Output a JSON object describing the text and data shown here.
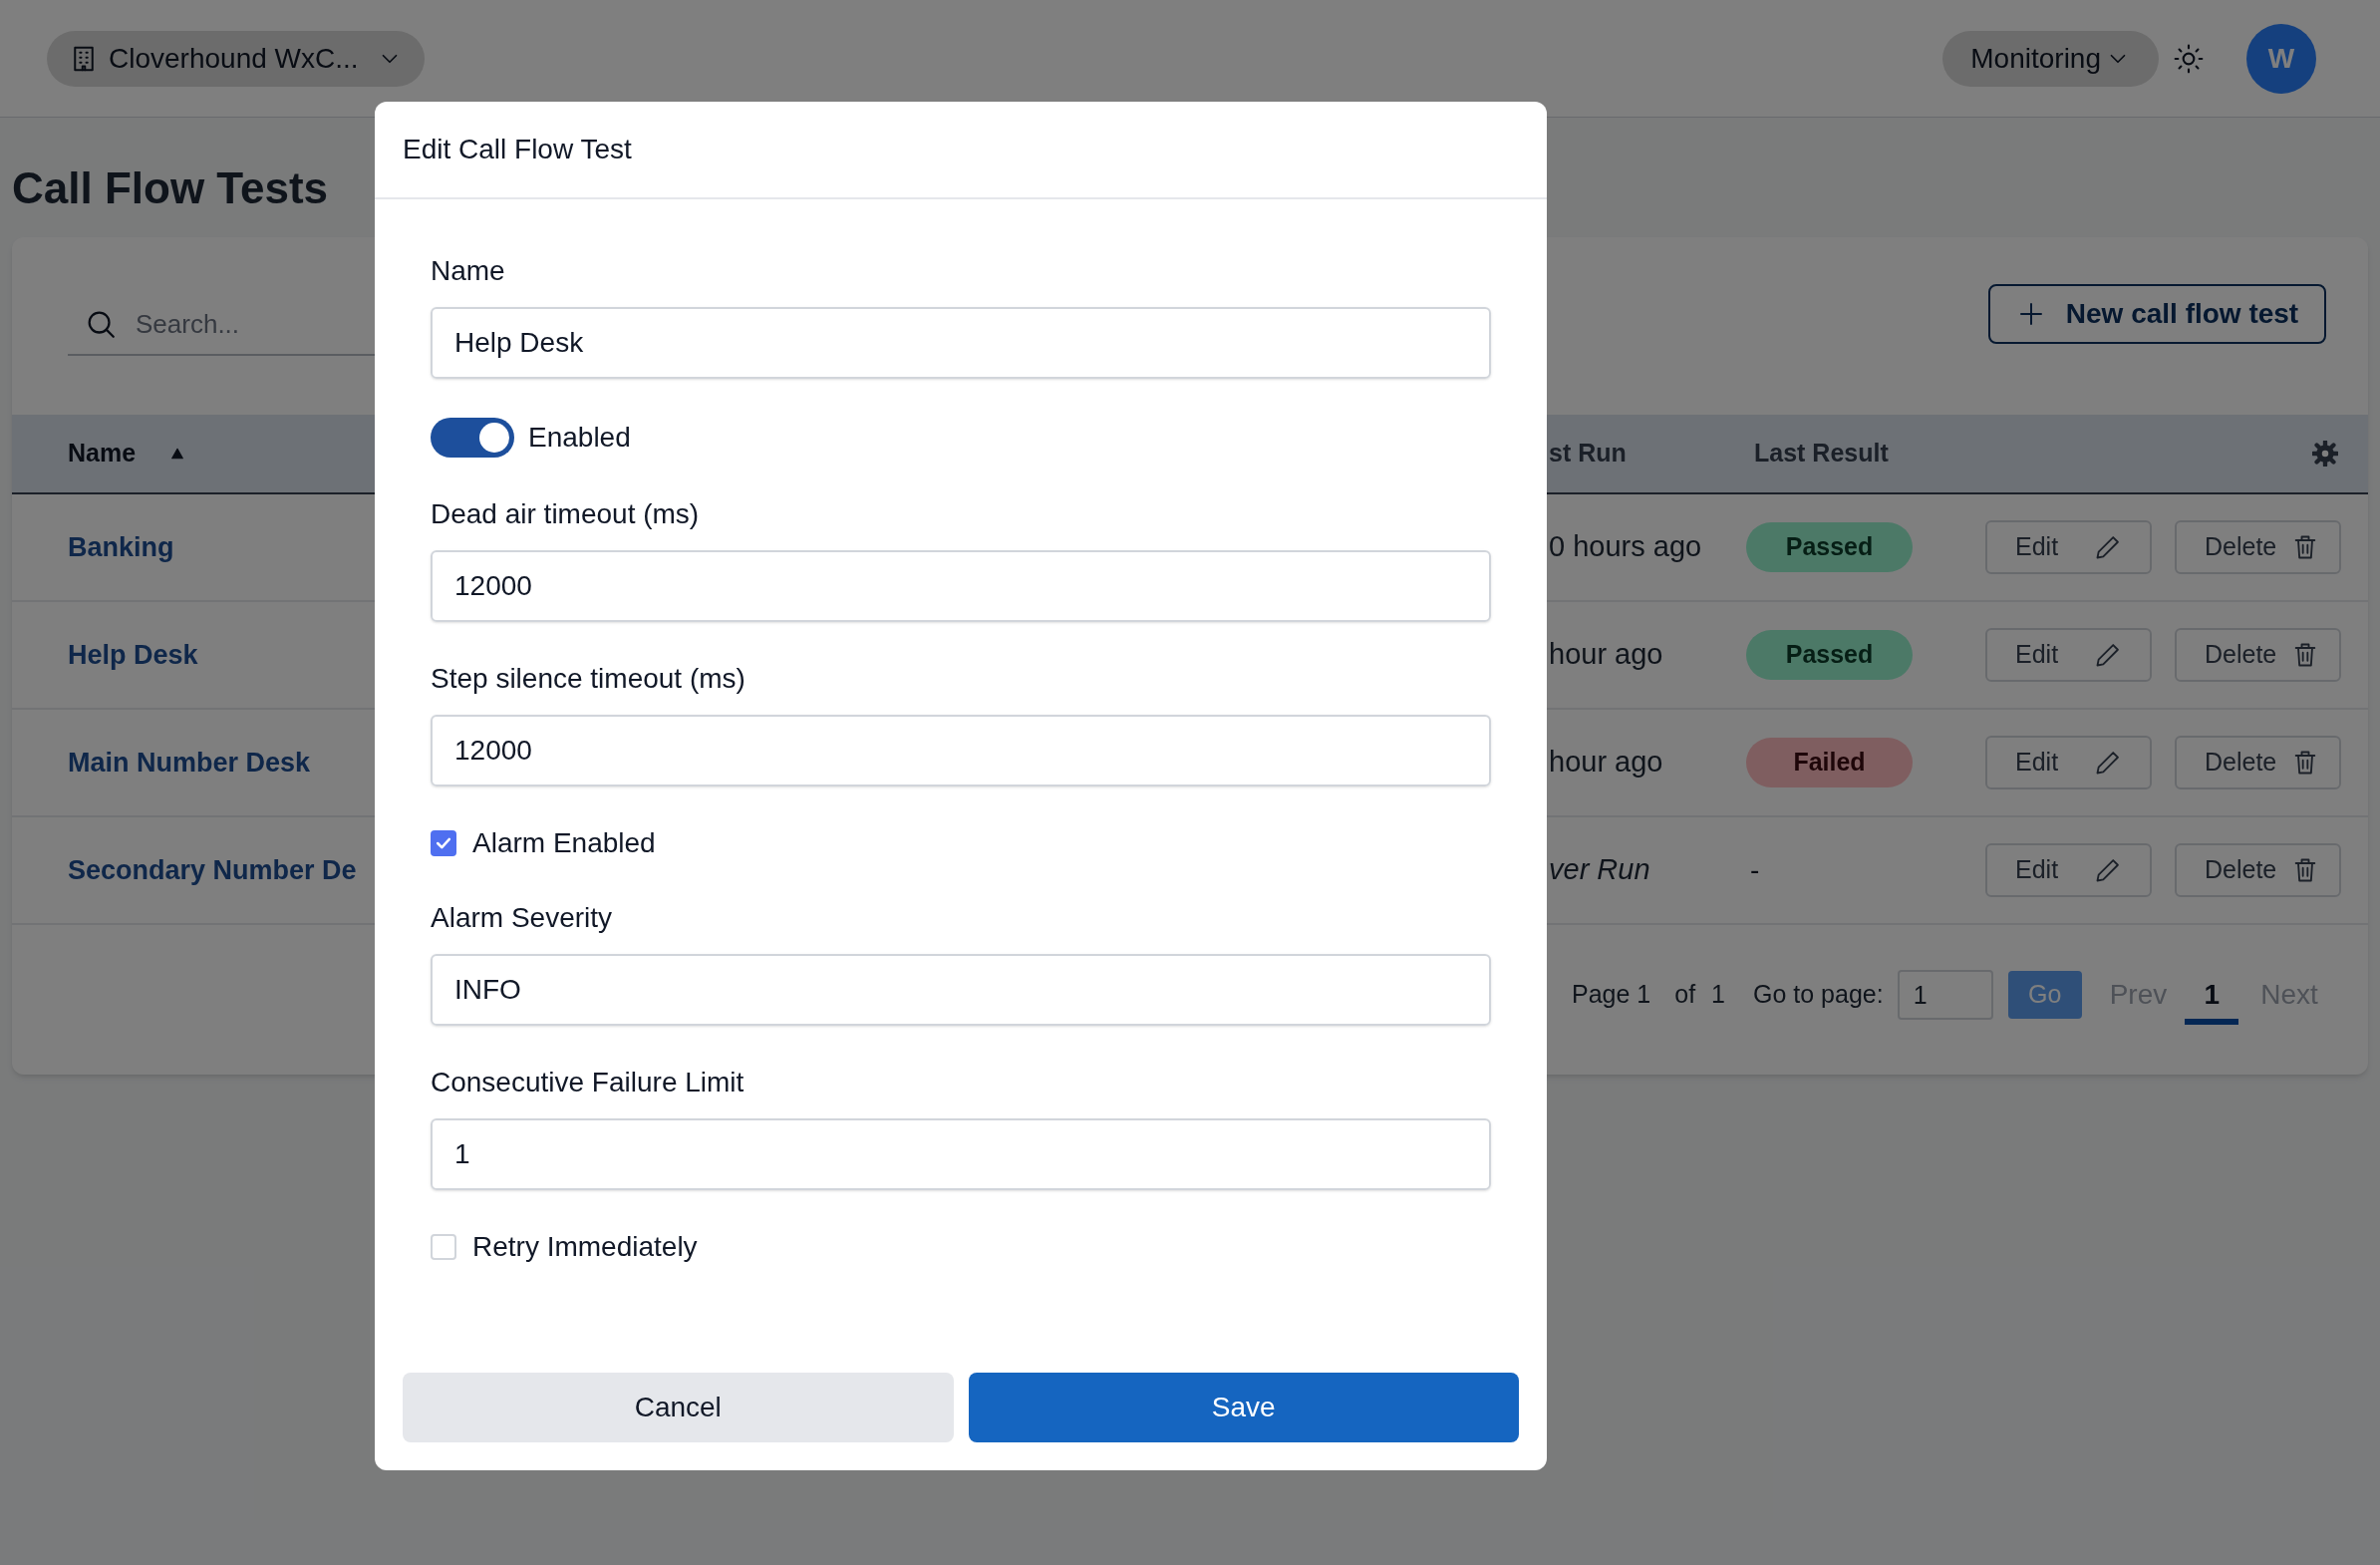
{
  "topbar": {
    "org_switcher": "Cloverhound WxC...",
    "menu": "Monitoring",
    "avatar": "W"
  },
  "page_title": "Call Flow Tests",
  "search": {
    "placeholder": "Search..."
  },
  "new_button": "New call flow test",
  "table": {
    "columns": [
      {
        "label": "Name",
        "sorted_ascending": true
      },
      {
        "label": "st Run"
      },
      {
        "label": "Last Result"
      }
    ],
    "rows": [
      {
        "name": "Banking",
        "column_2": "0 hours ago",
        "italic": false,
        "last_result": "Passed",
        "kind": "passed",
        "actions": [
          "Edit",
          "Delete"
        ]
      },
      {
        "name": "Help Desk",
        "column_2": "hour ago",
        "italic": false,
        "last_result": "Passed",
        "kind": "passed",
        "actions": [
          "Edit",
          "Delete"
        ]
      },
      {
        "name": "Main Number Desk",
        "column_2": "hour ago",
        "italic": false,
        "last_result": "Failed",
        "kind": "failed",
        "actions": [
          "Edit",
          "Delete"
        ]
      },
      {
        "name": "Secondary Number De",
        "column_2": "ver Run",
        "italic": true,
        "last_result": "-",
        "kind": "none",
        "actions": [
          "Edit",
          "Delete"
        ]
      }
    ]
  },
  "pagination": {
    "page_label": "Page 1",
    "of_label": "of",
    "total": "1",
    "goto_label": "Go to page:",
    "goto_value": "1",
    "go_button": "Go",
    "prev": "Prev",
    "next": "Next",
    "pages": [
      {
        "label": "1",
        "selected": true
      }
    ]
  },
  "modal": {
    "title": "Edit Call Flow Test",
    "fields": [
      {
        "kind": "input",
        "label": "Name",
        "value": "Help Desk"
      },
      {
        "kind": "toggle",
        "label": "Enabled",
        "on": true
      },
      {
        "kind": "input",
        "label": "Dead air timeout (ms)",
        "value": "12000"
      },
      {
        "kind": "input",
        "label": "Step silence timeout (ms)",
        "value": "12000"
      },
      {
        "kind": "checkbox",
        "label": "Alarm Enabled",
        "checked": true
      },
      {
        "kind": "input",
        "label": "Alarm Severity",
        "value": "INFO"
      },
      {
        "kind": "input",
        "label": "Consecutive Failure Limit",
        "value": "1"
      },
      {
        "kind": "checkbox",
        "label": "Retry Immediately",
        "checked": false
      }
    ],
    "buttons": [
      {
        "kind": "cancel",
        "label": "Cancel"
      },
      {
        "kind": "save",
        "label": "Save"
      }
    ]
  }
}
